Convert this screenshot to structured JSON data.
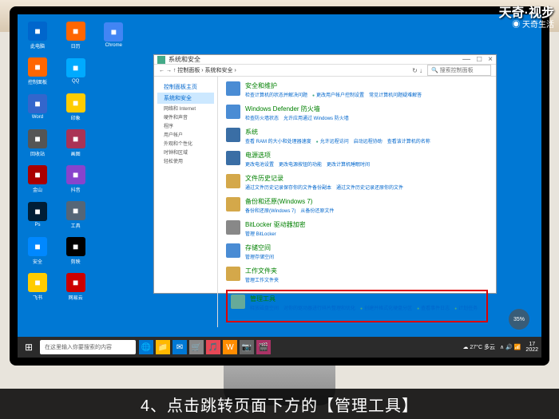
{
  "watermark1": "天奇·视步",
  "watermark2": "◉ 天奇生活",
  "caption": "4、点击跳转页面下方的【管理工具】",
  "window": {
    "title": "系统和安全",
    "breadcrumb": "← → ↑  控制面板 › 系统和安全 ›",
    "search_placeholder": "🔍 搜索控制面板",
    "controls": {
      "min": "—",
      "max": "□",
      "close": "×"
    }
  },
  "sidebar": {
    "home": "控制面板主页",
    "active": "系统和安全",
    "items": [
      "网络和 Internet",
      "硬件和声音",
      "程序",
      "用户帐户",
      "外观和个性化",
      "时钟和区域",
      "轻松使用"
    ]
  },
  "categories": [
    {
      "icon": "#4a8cd4",
      "title": "安全和维护",
      "links": [
        "检查计算机的状态并解决问题",
        "●更改用户帐户控制设置",
        "常见计算机问题疑难解答"
      ]
    },
    {
      "icon": "#4a8cd4",
      "title": "Windows Defender 防火墙",
      "links": [
        "检查防火墙状态",
        "允许应用通过 Windows 防火墙"
      ]
    },
    {
      "icon": "#3a6ea5",
      "title": "系统",
      "links": [
        "查看 RAM 的大小和处理器速度",
        "●允许远程访问",
        "启动远程协助",
        "查看该计算机的名称"
      ]
    },
    {
      "icon": "#3a6ea5",
      "title": "电源选项",
      "links": [
        "更改电池设置",
        "更改电源按钮的功能",
        "更改计算机睡眠时间"
      ]
    },
    {
      "icon": "#d4a84a",
      "title": "文件历史记录",
      "links": [
        "通过文件历史记录保存你的文件备份副本",
        "通过文件历史记录还原你的文件"
      ]
    },
    {
      "icon": "#d4a84a",
      "title": "备份和还原(Windows 7)",
      "links": [
        "备份和还原(Windows 7)",
        "从备份还原文件"
      ]
    },
    {
      "icon": "#888",
      "title": "BitLocker 驱动器加密",
      "links": [
        "管理 BitLocker"
      ]
    },
    {
      "icon": "#4a8cd4",
      "title": "存储空间",
      "links": [
        "管理存储空间"
      ]
    },
    {
      "icon": "#d4a84a",
      "title": "工作文件夹",
      "links": [
        "管理工作文件夹"
      ]
    }
  ],
  "admin_tools": {
    "title": "管理工具",
    "links": [
      "释放磁盘空间",
      "对你的驱动器进行碎片整理和优化",
      "●创建并格式化硬盘分区",
      "●查看事件日志",
      "●计划任务"
    ]
  },
  "desktop_icons": [
    {
      "c": "#0066cc",
      "t": "此电脑"
    },
    {
      "c": "#ff6600",
      "t": "控制面板"
    },
    {
      "c": "#3366cc",
      "t": "Word"
    },
    {
      "c": "#555",
      "t": "回收站"
    },
    {
      "c": "#aa0000",
      "t": "金山"
    },
    {
      "c": "#001e36",
      "t": "Ps"
    },
    {
      "c": "#0088ff",
      "t": "安全"
    },
    {
      "c": "#ffcc00",
      "t": "飞书"
    },
    {
      "c": "#ff6600",
      "t": "日历"
    },
    {
      "c": "#00aaff",
      "t": "QQ"
    },
    {
      "c": "#ffcc00",
      "t": "印象"
    },
    {
      "c": "#aa3355",
      "t": "画图"
    },
    {
      "c": "#8844cc",
      "t": "抖音"
    },
    {
      "c": "#556677",
      "t": "工具"
    },
    {
      "c": "#000",
      "t": "剪映"
    },
    {
      "c": "#cc0000",
      "t": "网易云"
    },
    {
      "c": "#4285f4",
      "t": "Chrome"
    }
  ],
  "taskbar": {
    "search": "在这里输入你要搜索的内容",
    "weather": "☁ 27°C 多云",
    "time": "17\n2022",
    "icons": [
      "🌐",
      "📁",
      "✉",
      "🛒",
      "🎵",
      "W",
      "📷",
      "🎬"
    ]
  },
  "badge": "35%"
}
